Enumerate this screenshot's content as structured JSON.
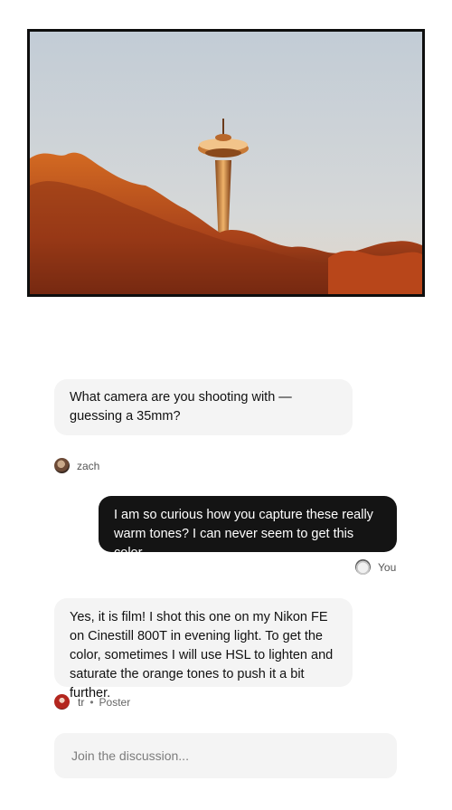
{
  "post": {
    "photo_subject": "space-needle-photo"
  },
  "comments": [
    {
      "direction": "incoming",
      "text": "What camera are you shooting with — guessing a 35mm?",
      "author": "zach"
    },
    {
      "direction": "outgoing",
      "text": "I am so curious how you capture these really warm tones? I can never seem to get this color.",
      "author": "You"
    },
    {
      "direction": "incoming",
      "text": "Yes, it is film! I shot this one on my Nikon FE on Cinestill 800T in evening light.  To get the color, sometimes I will use HSL to lighten and saturate the orange tones to push it a bit further.",
      "author": "tr",
      "separator": "•",
      "role": "Poster"
    }
  ],
  "composer": {
    "placeholder": "Join the discussion..."
  },
  "colors": {
    "incoming_bubble": "#f4f4f4",
    "outgoing_bubble": "#141414",
    "sky": "#cfd6dc",
    "foliage": "#c45a1c"
  }
}
